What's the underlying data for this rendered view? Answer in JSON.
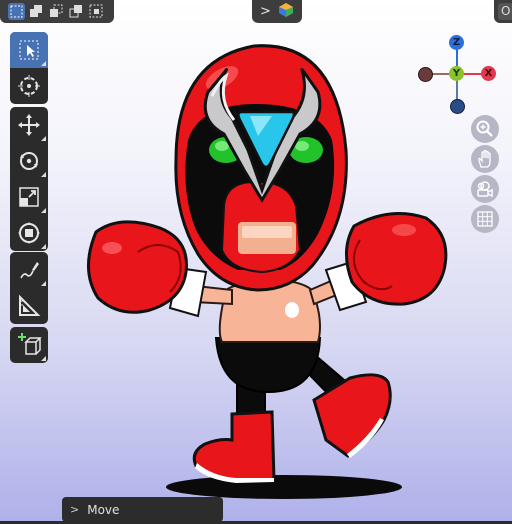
{
  "header": {
    "selection_modes": [
      "select-box-new-icon",
      "select-box-extend-icon",
      "select-box-subtract-icon",
      "select-box-invert-icon",
      "select-box-intersect-icon"
    ],
    "gizmo_chevron": ">",
    "right_label": "O"
  },
  "toolbar": {
    "tools": [
      {
        "icon": "select-box-icon",
        "active": true
      },
      {
        "icon": "cursor-icon",
        "active": false
      },
      {
        "icon": "move-icon",
        "active": false
      },
      {
        "icon": "rotate-icon",
        "active": false
      },
      {
        "icon": "scale-icon",
        "active": false
      },
      {
        "icon": "transform-icon",
        "active": false
      },
      {
        "icon": "annotate-icon",
        "active": false
      },
      {
        "icon": "measure-icon",
        "active": false
      },
      {
        "icon": "add-cube-icon",
        "active": false
      }
    ]
  },
  "nav_gizmo": {
    "z_label": "Z",
    "y_label": "Y",
    "x_label": "X",
    "colors": {
      "z": "#2b6fd8",
      "y": "#8bc32c",
      "x": "#e0394e",
      "neg": "#5a3a3a",
      "neg_z": "#2a4c86"
    }
  },
  "nav_buttons": [
    "zoom-icon",
    "hand-pan-icon",
    "camera-icon",
    "grid-ortho-icon"
  ],
  "operator_panel": {
    "arrow": ">",
    "label": "Move"
  },
  "colors": {
    "accent": "#4772b3",
    "panel": "#2b2b2b",
    "character_red": "#ee1c1c"
  }
}
